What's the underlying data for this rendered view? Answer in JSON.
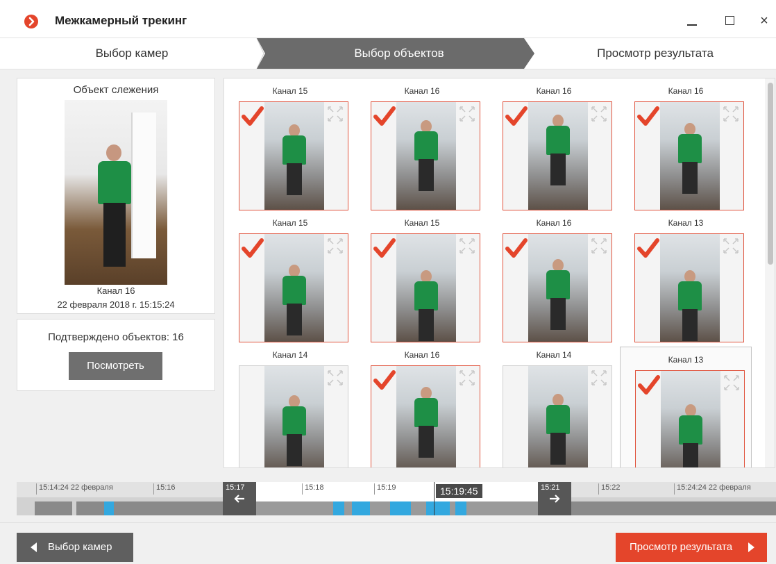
{
  "window": {
    "title": "Межкамерный трекинг",
    "close_glyph": "×",
    "accent_color": "#e4452b"
  },
  "steps": [
    {
      "label": "Выбор камер"
    },
    {
      "label": "Выбор объектов"
    },
    {
      "label": "Просмотр результата"
    }
  ],
  "tracked_object": {
    "title": "Объект слежения",
    "channel": "Канал 16",
    "datetime": "22 февраля 2018 г. 15:15:24"
  },
  "confirmation": {
    "text": "Подтверждено объектов: 16",
    "view_button": "Посмотреть"
  },
  "results": [
    {
      "channel": "Канал 15",
      "checked": true
    },
    {
      "channel": "Канал 16",
      "checked": true
    },
    {
      "channel": "Канал 16",
      "checked": true
    },
    {
      "channel": "Канал 16",
      "checked": true
    },
    {
      "channel": "Канал 15",
      "checked": true
    },
    {
      "channel": "Канал 15",
      "checked": true
    },
    {
      "channel": "Канал 16",
      "checked": true
    },
    {
      "channel": "Канал 13",
      "checked": true
    },
    {
      "channel": "Канал 14",
      "checked": false
    },
    {
      "channel": "Канал 16",
      "checked": true
    },
    {
      "channel": "Канал 14",
      "checked": false
    },
    {
      "channel": "Канал 13",
      "checked": true,
      "selected": true
    }
  ],
  "timeline": {
    "start_label": "15:14:24 22 февраля",
    "end_label": "15:24:24 22 февраля",
    "ticks": [
      "15:16",
      "15:17",
      "15:18",
      "15:19",
      "15:21",
      "15:22"
    ],
    "cursor_time": "15:19:45"
  },
  "footer": {
    "back_button": "Выбор камер",
    "next_button": "Просмотр результата"
  }
}
